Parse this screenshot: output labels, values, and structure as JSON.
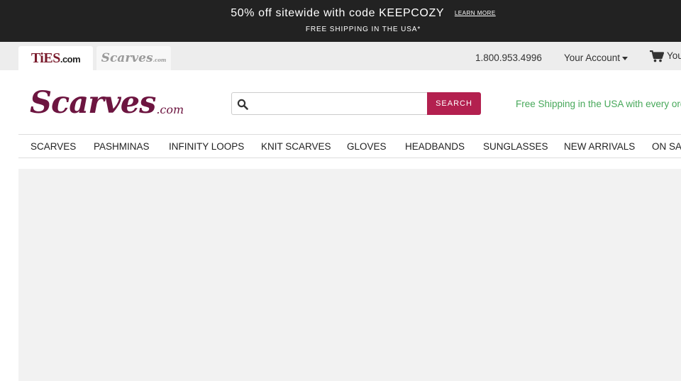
{
  "promo": {
    "headline": "50% off sitewide with code KEEPCOZY",
    "learn_more": "LEARN MORE",
    "subline": "FREE SHIPPING IN THE USA*"
  },
  "site_tabs": {
    "ties_logo": "TiES",
    "ties_dotcom": ".com",
    "scarves_logo": "Scarves",
    "scarves_dotcom": ".com"
  },
  "utility": {
    "phone": "1.800.953.4996",
    "account": "Your Account",
    "cart": "You"
  },
  "brand": {
    "logo_text": "Scarves",
    "logo_dotcom": ".com",
    "color": "#6d1540"
  },
  "search": {
    "value": "",
    "placeholder": "",
    "button": "SEARCH",
    "button_color": "#b3204f"
  },
  "shipping_message": "Free Shipping in the USA with every ord",
  "nav": {
    "items": [
      {
        "label": "SCARVES"
      },
      {
        "label": "PASHMINAS"
      },
      {
        "label": "INFINITY LOOPS"
      },
      {
        "label": "KNIT SCARVES"
      },
      {
        "label": "GLOVES"
      },
      {
        "label": "HEADBANDS"
      },
      {
        "label": "SUNGLASSES"
      },
      {
        "label": "NEW ARRIVALS"
      },
      {
        "label": "ON SAL"
      }
    ]
  },
  "icons": {
    "search": "search-icon",
    "cart": "shopping-cart-icon",
    "account_caret": "caret-down-icon"
  }
}
